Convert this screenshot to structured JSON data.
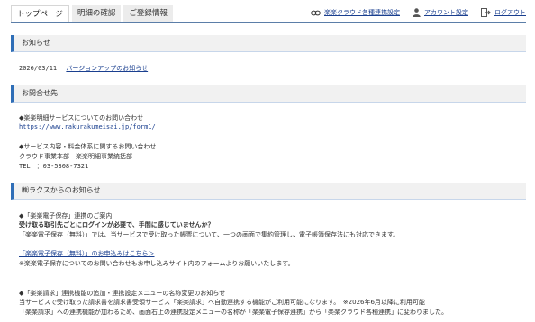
{
  "nav": {
    "tabs": [
      "トップページ",
      "明細の確認",
      "ご登録情報"
    ],
    "links": {
      "cloud": "楽楽クラウド各種連携設定",
      "account": "アカウント設定",
      "logout": "ログアウト"
    }
  },
  "notices": {
    "title": "お知らせ",
    "date": "2026/03/11",
    "link": "バージョンアップのお知らせ"
  },
  "contact": {
    "title": "お問合せ先",
    "line1": "◆楽楽明細サービスについてのお問い合わせ",
    "url": "https://www.rakurakumeisai.jp/form1/",
    "line2": "◆サービス内容・料金体系に関するお問い合わせ",
    "line3": "クラウド事業本部　楽楽明細事業統括部",
    "tel": "TEL　：03-5308-7321"
  },
  "raksul": {
    "title": "㈱ラクスからのお知らせ",
    "a1": "◆「楽楽電子保存」連携のご案内",
    "a2": "受け取る取引先ごとにログインが必要で、手間に感じていませんか？",
    "a3": "「楽楽電子保存（無料）」では、当サービスで受け取った帳票について、一つの画面で集約管理し、電子帳簿保存法にも対応できます。",
    "a4": "「楽楽電子保存（無料）」のお申込みはこちら＞",
    "a5": "※楽楽電子保存についてのお問い合わせもお申し込みサイト内のフォームよりお願いいたします。",
    "b1": "◆「楽楽請求」連携機能の追加・連携設定メニューの名称変更のお知らせ",
    "b2": "当サービスで受け取った請求書を請求書受領サービス「楽楽請求」へ自動連携する機能がご利用可能になります。　※2026年6月以降に利用可能",
    "b3": "「楽楽請求」への連携機能が加わるため、画面右上の連携設定メニューの名称が「楽楽電子保存連携」から「楽楽クラウド各種連携」に変わりました。"
  },
  "colors": {
    "accent": "#2f6eb7",
    "link": "#1a3f8f",
    "tabline": "#5b7ea8"
  }
}
